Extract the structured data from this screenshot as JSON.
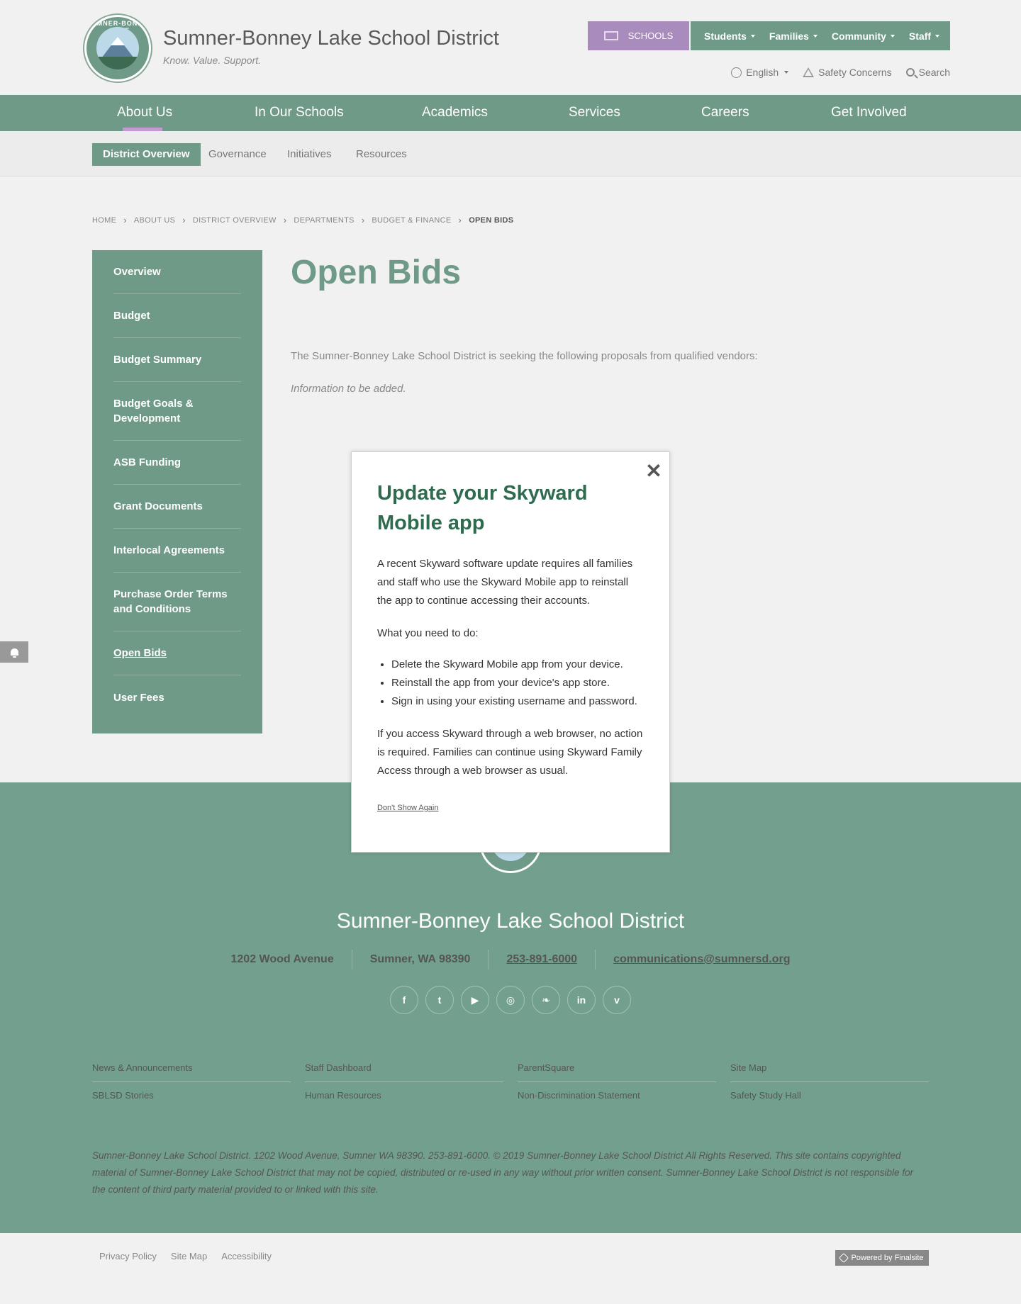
{
  "header": {
    "site_title": "Sumner-Bonney Lake School District",
    "tagline": "Know. Value. Support.",
    "logo_text": "SUMNER-BONNEY LAKE",
    "schools_label": "SCHOOLS",
    "audience": [
      "Students",
      "Families",
      "Community",
      "Staff"
    ],
    "language": "English",
    "safety": "Safety Concerns",
    "search": "Search"
  },
  "mainnav": [
    "About Us",
    "In Our Schools",
    "Academics",
    "Services",
    "Careers",
    "Get Involved"
  ],
  "subnav": [
    "District Overview",
    "Governance",
    "Initiatives",
    "Resources"
  ],
  "breadcrumb": [
    "HOME",
    "ABOUT US",
    "DISTRICT OVERVIEW",
    "DEPARTMENTS",
    "BUDGET & FINANCE",
    "OPEN BIDS"
  ],
  "sidebar": [
    "Overview",
    "Budget",
    "Budget Summary",
    "Budget Goals & Development",
    "ASB Funding",
    "Grant Documents",
    "Interlocal Agreements",
    "Purchase Order Terms and Conditions",
    "Open Bids",
    "User Fees"
  ],
  "content": {
    "title": "Open Bids",
    "intro": "The Sumner-Bonney Lake School District is seeking the following proposals from qualified vendors:",
    "info": "Information to be added."
  },
  "modal": {
    "close": "✕",
    "title": "Update your Skyward Mobile app",
    "p1": "A recent Skyward software update requires all families and staff who use the Skyward Mobile app to reinstall the app to continue accessing their accounts.",
    "p2": "What you need to do:",
    "steps": [
      "Delete the Skyward Mobile app from your device.",
      "Reinstall the app from your device's app store.",
      "Sign in using your existing username and password."
    ],
    "p3": "If you access Skyward through a web browser, no action is required. Families can continue using Skyward Family Access through a web browser as usual.",
    "dont_show": "Don't Show Again"
  },
  "footer": {
    "title": "Sumner-Bonney Lake School District",
    "address": "1202 Wood Avenue",
    "city": "Sumner, WA  98390",
    "phone": "253-891-6000",
    "email": "communications@sumnersd.org",
    "socials": [
      "f",
      "t",
      "▶",
      "◎",
      "❧",
      "in",
      "v"
    ],
    "links": [
      "News & Announcements",
      "Staff Dashboard",
      "ParentSquare",
      "Site Map",
      "SBLSD Stories",
      "Human Resources",
      "Non-Discrimination Statement",
      "Safety Study Hall"
    ],
    "copyright": "Sumner-Bonney Lake School District. 1202 Wood Avenue, Sumner WA 98390. 253-891-6000. © 2019 Sumner-Bonney Lake School District All Rights Reserved. This site contains copyrighted material of Sumner-Bonney Lake School District that may not be copied, distributed or re-used in any way without prior written consent. Sumner-Bonney Lake School District is not responsible for the content of third party material provided to or linked with this site."
  },
  "bottom": {
    "links": [
      "Privacy Policy",
      "Site Map",
      "Accessibility"
    ],
    "powered": "Powered by Finalsite"
  },
  "colors": {
    "primary": "#6f9a88",
    "accent": "#a98bbd",
    "heading": "#2f6b4f"
  }
}
